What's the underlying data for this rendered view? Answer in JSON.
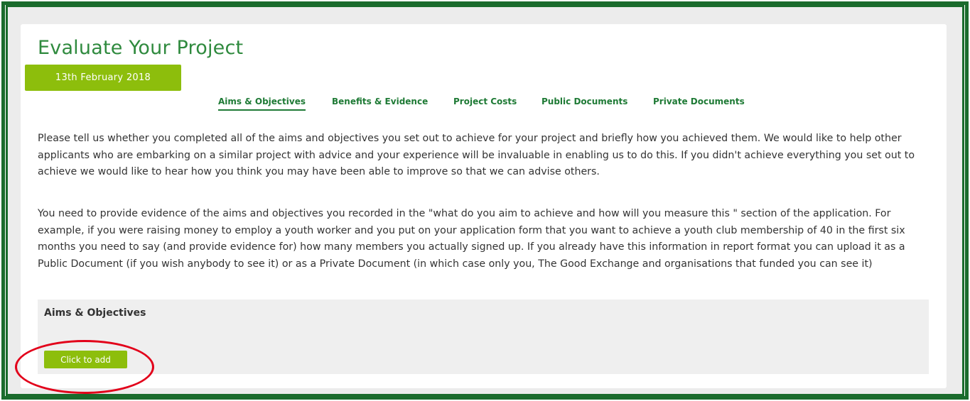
{
  "page": {
    "title": "Evaluate Your Project",
    "date": "13th February 2018"
  },
  "tabs": [
    {
      "label": "Aims & Objectives",
      "active": true
    },
    {
      "label": "Benefits & Evidence",
      "active": false
    },
    {
      "label": "Project Costs",
      "active": false
    },
    {
      "label": "Public Documents",
      "active": false
    },
    {
      "label": "Private Documents",
      "active": false
    }
  ],
  "content": {
    "paragraph_1": "Please tell us whether you completed all of the aims and objectives you set out to achieve for your project and briefly how you achieved them. We would like to help other applicants who are embarking on a similar project with advice and your experience will be invaluable in enabling us to do this. If you didn't achieve everything you set out to achieve we would like to hear how you think you may have been able to improve so that we can advise others.",
    "paragraph_2": "You need to provide evidence of the aims and objectives you recorded in the \"what do you aim to achieve and how will you measure this \" section of the application. For example, if you were raising money to employ a youth worker and you put on your application form that you want to achieve a youth club membership of 40 in the first six months you need to say (and provide evidence for) how many members you actually signed up. If you already have this information in report format you can upload it as a Public Document (if you wish anybody to see it) or as a Private Document (in which case only you, The Good Exchange and organisations that funded you can see it)"
  },
  "aims_section": {
    "heading": "Aims & Objectives",
    "add_button_label": "Click to add"
  },
  "colors": {
    "frame_green": "#1a6b2c",
    "title_green": "#2f8a3e",
    "tab_green": "#1e7a35",
    "accent_lime": "#8dbe0c",
    "highlight_red": "#e2001a"
  }
}
